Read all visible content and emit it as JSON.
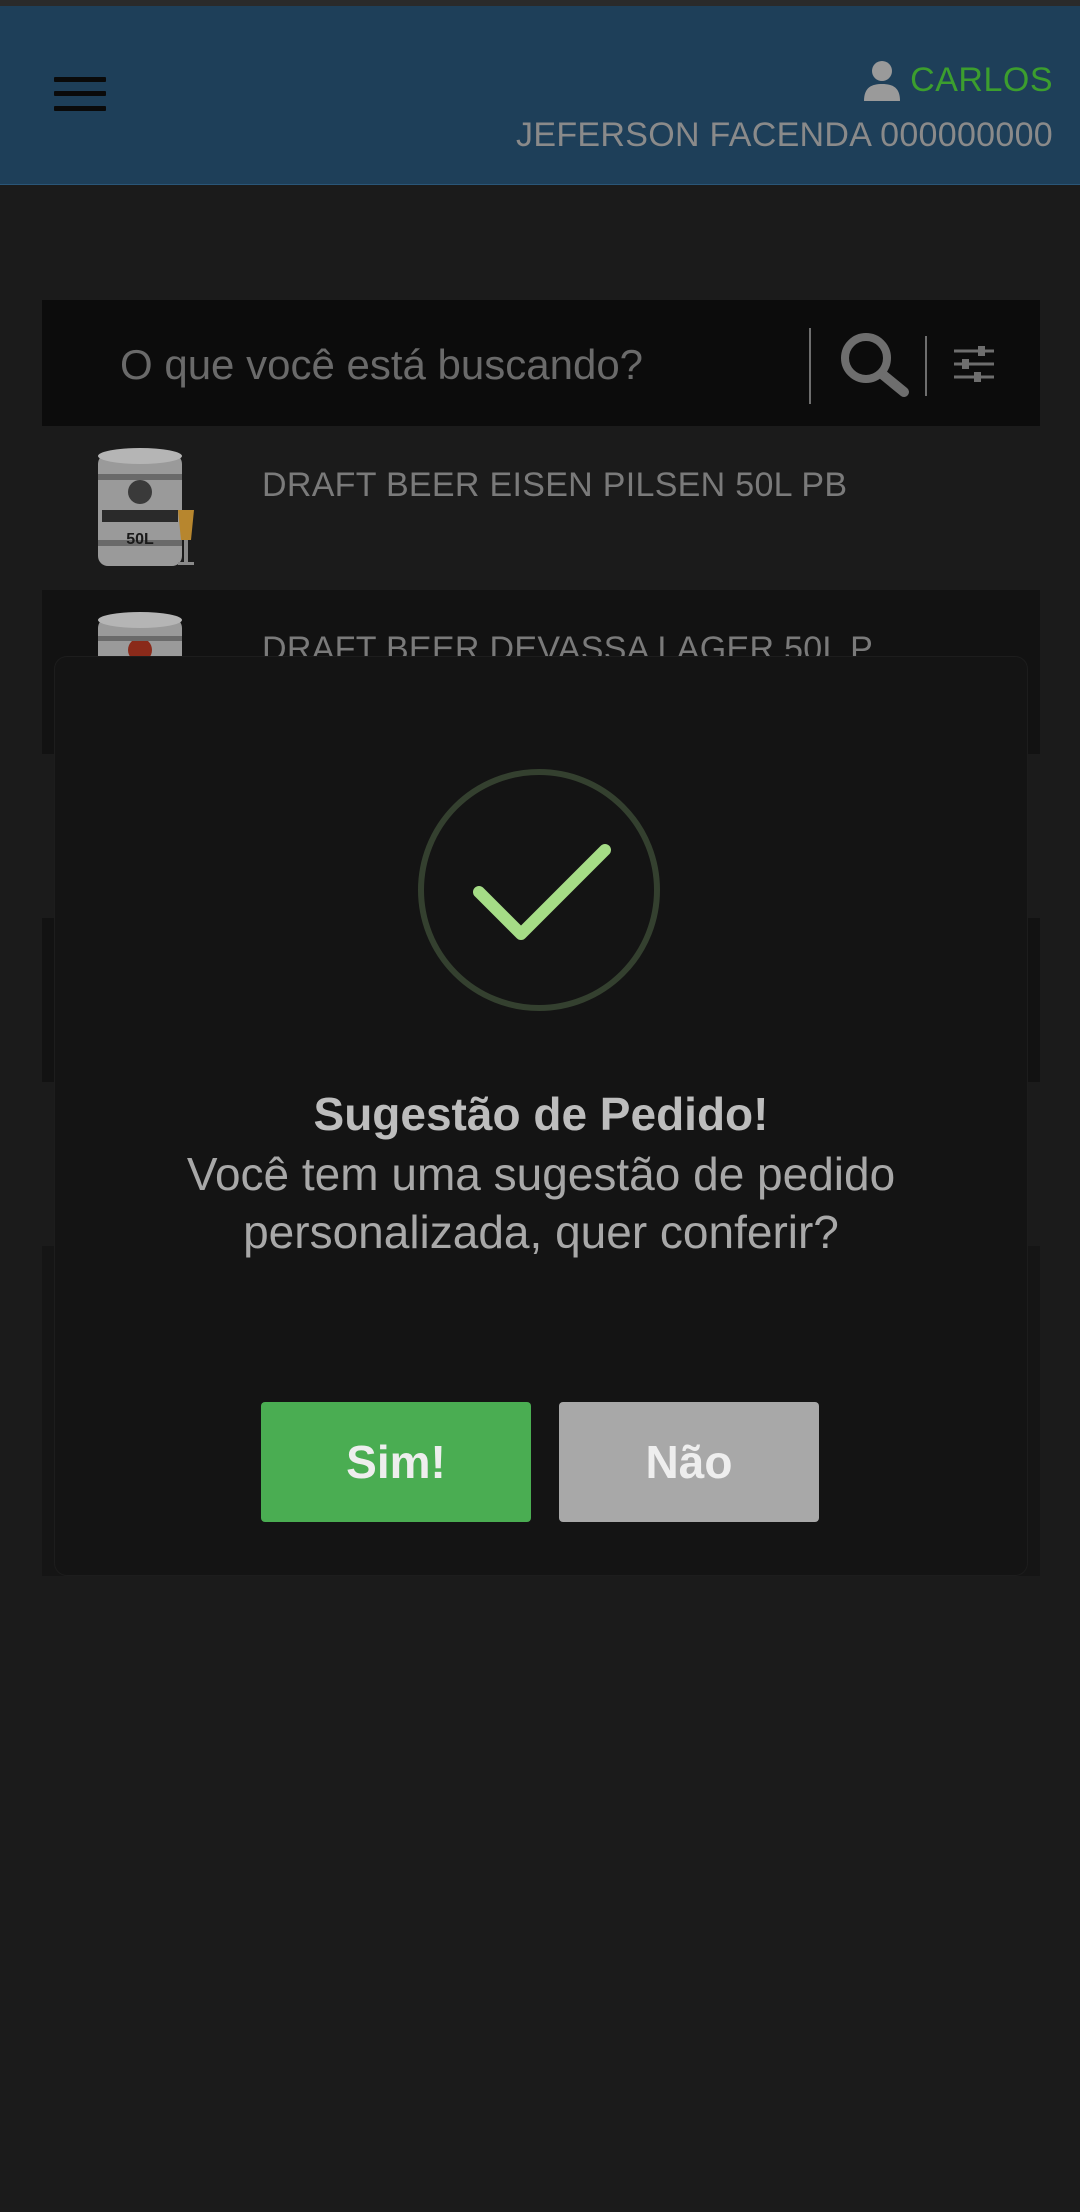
{
  "header": {
    "user_name": "CARLOS",
    "account": "JEFERSON FACENDA 000000000",
    "background": "#1e3f59",
    "user_color": "#3c9e2e"
  },
  "search": {
    "placeholder": "O que você está buscando?"
  },
  "products": [
    {
      "name": "DRAFT BEER EISEN PILSEN 50L PB",
      "image_label": "50L"
    },
    {
      "name": "DRAFT BEER DEVASSA LAGER 50L P"
    }
  ],
  "modal": {
    "title": "Sugestão de Pedido!",
    "message": "Você tem uma sugestão de pedido personalizada, quer conferir?",
    "yes_label": "Sim!",
    "no_label": "Não",
    "yes_color": "#4aad52",
    "no_color": "#a8a8a8"
  },
  "icons": [
    "menu-icon",
    "user-icon",
    "search-icon",
    "filter-icon",
    "check-icon"
  ]
}
